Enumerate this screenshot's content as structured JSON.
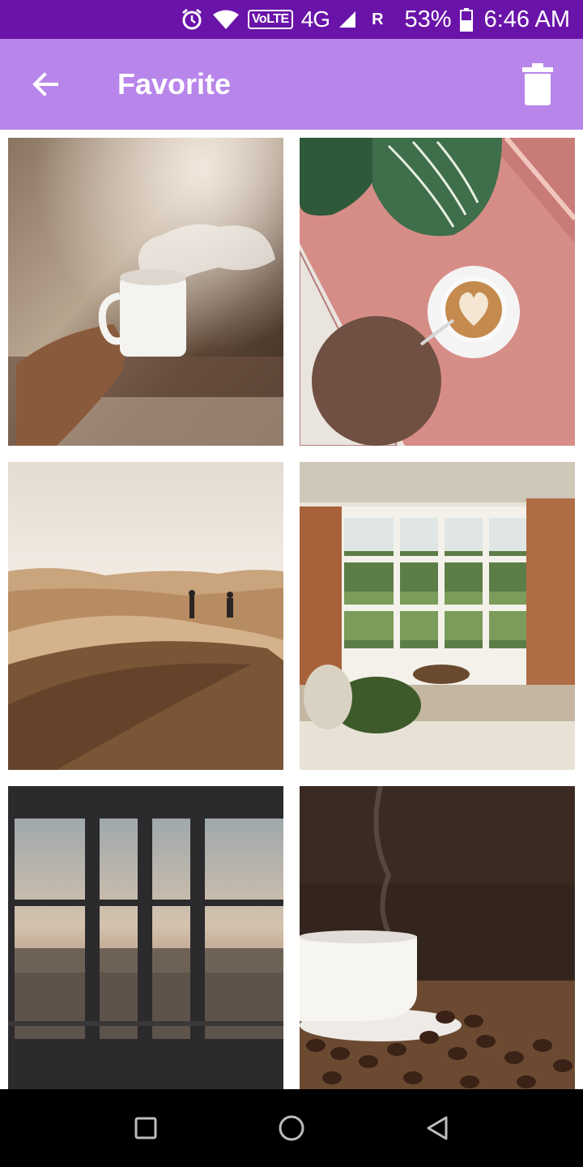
{
  "status_bar": {
    "volte": "VoLTE",
    "network": "4G",
    "roaming": "R",
    "battery": "53%",
    "time": "6:46 AM",
    "icons": [
      "alarm-icon",
      "wifi-icon",
      "signal-icon",
      "battery-icon"
    ]
  },
  "app_bar": {
    "title": "Favorite",
    "back_icon": "arrow-back-icon",
    "delete_icon": "trash-icon",
    "background": "#b886ea"
  },
  "colors": {
    "status_bar": "#6a13a8",
    "app_bar": "#b886ea",
    "nav_bar": "#000000"
  },
  "favorites": [
    {
      "subject": "steaming coffee cup held in hand"
    },
    {
      "subject": "latte art cup on pink table with leaves"
    },
    {
      "subject": "two people walking on desert dunes"
    },
    {
      "subject": "window seat with cushion and curtains"
    },
    {
      "subject": "city view through tall window"
    },
    {
      "subject": "white coffee cup on coffee beans"
    }
  ],
  "nav_bar": {
    "icons": [
      "recent-apps-icon",
      "home-icon",
      "back-icon"
    ]
  }
}
